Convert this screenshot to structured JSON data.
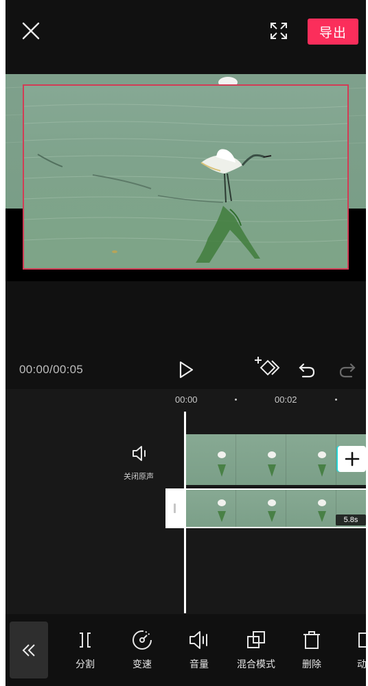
{
  "top_bar": {
    "close_icon": "close-icon",
    "fullscreen_icon": "fullscreen-icon",
    "export_label": "导出",
    "accent_color": "#fb2e5b"
  },
  "preview": {
    "selection_border_color": "#d23c55"
  },
  "transport": {
    "timecode": "00:00/00:05",
    "play_icon": "play-icon",
    "keyframe_icon": "add-keyframe-icon",
    "undo_icon": "undo-icon",
    "redo_icon": "redo-icon"
  },
  "timeline": {
    "ruler": [
      "00:00",
      "00:02"
    ],
    "mute_label": "关闭原声",
    "duration": "5.8s",
    "add_icon": "plus-icon"
  },
  "toolbar": {
    "collapse_icon": "double-chevron-left-icon",
    "tools": [
      {
        "label": "分割",
        "icon": "split-icon"
      },
      {
        "label": "变速",
        "icon": "speed-icon"
      },
      {
        "label": "音量",
        "icon": "volume-icon"
      },
      {
        "label": "混合模式",
        "icon": "blend-mode-icon"
      },
      {
        "label": "删除",
        "icon": "delete-icon"
      },
      {
        "label": "动",
        "icon": "animation-icon"
      }
    ]
  }
}
